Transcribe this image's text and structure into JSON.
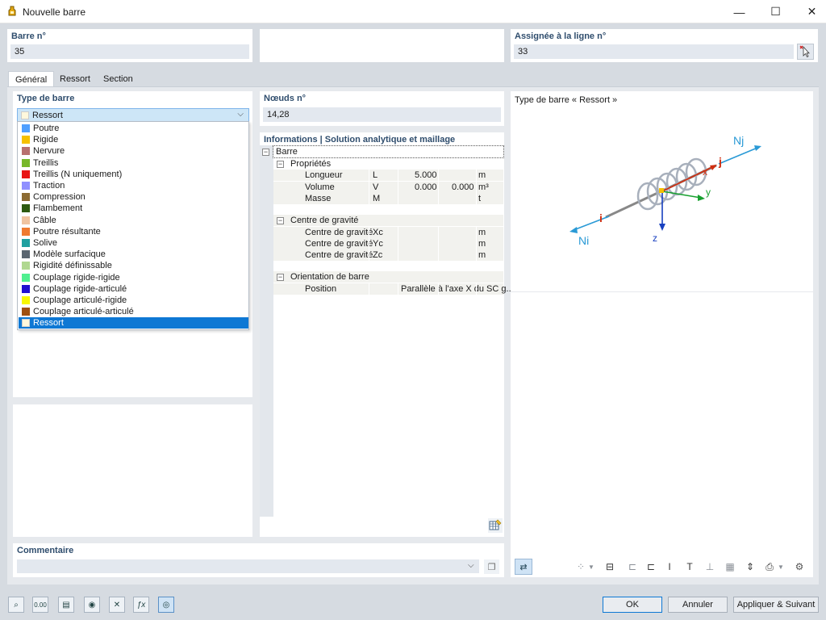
{
  "window": {
    "title": "Nouvelle barre",
    "minimize": "—",
    "maximize": "☐",
    "close": "✕"
  },
  "header": {
    "bar_no_label": "Barre n°",
    "bar_no_value": "35",
    "assigned_label": "Assignée à la ligne n°",
    "assigned_value": "33"
  },
  "tabs": [
    {
      "label": "Général"
    },
    {
      "label": "Ressort"
    },
    {
      "label": "Section"
    }
  ],
  "bar_type": {
    "label": "Type de barre",
    "selected": "Ressort",
    "selected_color": "#fff8dc",
    "options": [
      {
        "label": "Poutre",
        "color": "#4f9fff"
      },
      {
        "label": "Rigide",
        "color": "#f5c000"
      },
      {
        "label": "Nervure",
        "color": "#b87070"
      },
      {
        "label": "Treillis",
        "color": "#77b82a"
      },
      {
        "label": "Treillis (N uniquement)",
        "color": "#e81515"
      },
      {
        "label": "Traction",
        "color": "#8f8fff"
      },
      {
        "label": "Compression",
        "color": "#8c6b32"
      },
      {
        "label": "Flambement",
        "color": "#2d5a10"
      },
      {
        "label": "Câble",
        "color": "#f0c4a0"
      },
      {
        "label": "Poutre résultante",
        "color": "#f07a30"
      },
      {
        "label": "Solive",
        "color": "#20a0a0"
      },
      {
        "label": "Modèle surfacique",
        "color": "#5a6570"
      },
      {
        "label": "Rigidité définissable",
        "color": "#b0d890"
      },
      {
        "label": "Couplage rigide-rigide",
        "color": "#50f090"
      },
      {
        "label": "Couplage rigide-articulé",
        "color": "#2010d0"
      },
      {
        "label": "Couplage articulé-rigide",
        "color": "#f8f800"
      },
      {
        "label": "Couplage articulé-articulé",
        "color": "#a05010"
      },
      {
        "label": "Ressort",
        "color": "#fff8dc"
      }
    ]
  },
  "nodes": {
    "label": "Nœuds n°",
    "value": "14,28"
  },
  "info": {
    "title": "Informations | Solution analytique et maillage",
    "root": "Barre",
    "groups": [
      {
        "label": "Propriétés",
        "rows": [
          {
            "name": "Longueur",
            "symbol": "L",
            "value": "5.000",
            "value2": "",
            "unit": "m"
          },
          {
            "name": "Volume",
            "symbol": "V",
            "value": "0.000",
            "value2": "0.000",
            "unit": "m³"
          },
          {
            "name": "Masse",
            "symbol": "M",
            "value": "",
            "value2": "",
            "unit": "t"
          }
        ]
      },
      {
        "label": "Centre de gravité",
        "rows": [
          {
            "name": "Centre de gravité",
            "symbol": "Xc",
            "value": "",
            "value2": "",
            "unit": "m"
          },
          {
            "name": "Centre de gravité",
            "symbol": "Yc",
            "value": "",
            "value2": "",
            "unit": "m"
          },
          {
            "name": "Centre de gravité",
            "symbol": "Zc",
            "value": "",
            "value2": "",
            "unit": "m"
          }
        ]
      },
      {
        "label": "Orientation de barre",
        "rows": [
          {
            "name": "Position",
            "symbol": "",
            "value": "Parallèle à l'axe X du SC g...",
            "value2": "",
            "unit": ""
          }
        ]
      }
    ]
  },
  "preview": {
    "title": "Type de barre « Ressort »",
    "labels": {
      "nj": "Nj",
      "ni": "Ni",
      "i": "i",
      "j": "j",
      "x": "x",
      "y": "y",
      "z": "z"
    }
  },
  "comment": {
    "label": "Commentaire",
    "value": ""
  },
  "buttons": {
    "ok": "OK",
    "cancel": "Annuler",
    "apply_next": "Appliquer & Suivant"
  },
  "bottom_icons": [
    "search-icon",
    "numeric-icon",
    "table-icon",
    "view-icon",
    "member-icon",
    "formula-icon",
    "display-icon"
  ],
  "right_tools": [
    "snap-icon",
    "member-section-icon",
    "dim-left-icon",
    "dim-bracket-icon",
    "i-section-icon",
    "t-section-icon",
    "underline-icon",
    "grid-icon",
    "vertical-dim-icon",
    "print-icon",
    "settings-icon"
  ]
}
